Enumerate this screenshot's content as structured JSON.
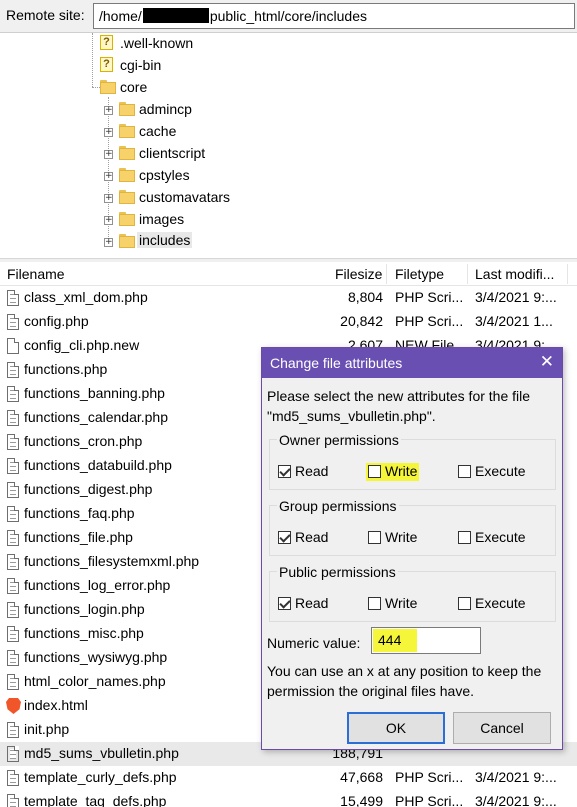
{
  "remote_bar": {
    "label": "Remote site:",
    "path_prefix": "/home/",
    "path_suffix": "public_html/core/includes"
  },
  "tree": {
    "items": [
      {
        "label": ".well-known",
        "icon": "question-icon"
      },
      {
        "label": "cgi-bin",
        "icon": "question-icon"
      },
      {
        "label": "core",
        "icon": "folder-icon"
      },
      {
        "label": "admincp",
        "icon": "folder-icon"
      },
      {
        "label": "cache",
        "icon": "folder-icon"
      },
      {
        "label": "clientscript",
        "icon": "folder-icon"
      },
      {
        "label": "cpstyles",
        "icon": "folder-icon"
      },
      {
        "label": "customavatars",
        "icon": "folder-icon"
      },
      {
        "label": "images",
        "icon": "folder-icon"
      },
      {
        "label": "includes",
        "icon": "folder-icon"
      }
    ],
    "expander_symbol": "+",
    "scroll_up_symbol": "^"
  },
  "filelist": {
    "headers": {
      "filename": "Filename",
      "filesize": "Filesize",
      "filetype": "Filetype",
      "last_modified": "Last modifi..."
    },
    "rows": [
      {
        "name": "class_xml_dom.php",
        "size": "8,804",
        "type": "PHP Scri...",
        "date": "3/4/2021 9:...",
        "icon": "file-lines-icon"
      },
      {
        "name": "config.php",
        "size": "20,842",
        "type": "PHP Scri...",
        "date": "3/4/2021 1...",
        "icon": "file-lines-icon"
      },
      {
        "name": "config_cli.php.new",
        "size": "2,607",
        "type": "NEW File",
        "date": "3/4/2021 9:...",
        "icon": "file-blank-icon"
      },
      {
        "name": "functions.php",
        "size": "",
        "type": "",
        "date": "",
        "icon": "file-lines-icon"
      },
      {
        "name": "functions_banning.php",
        "size": "",
        "type": "",
        "date": "",
        "icon": "file-lines-icon"
      },
      {
        "name": "functions_calendar.php",
        "size": "",
        "type": "",
        "date": "",
        "icon": "file-lines-icon"
      },
      {
        "name": "functions_cron.php",
        "size": "",
        "type": "",
        "date": "",
        "icon": "file-lines-icon"
      },
      {
        "name": "functions_databuild.php",
        "size": "",
        "type": "",
        "date": "",
        "icon": "file-lines-icon"
      },
      {
        "name": "functions_digest.php",
        "size": "",
        "type": "",
        "date": "",
        "icon": "file-lines-icon"
      },
      {
        "name": "functions_faq.php",
        "size": "",
        "type": "",
        "date": "",
        "icon": "file-lines-icon"
      },
      {
        "name": "functions_file.php",
        "size": "",
        "type": "",
        "date": "",
        "icon": "file-lines-icon"
      },
      {
        "name": "functions_filesystemxml.php",
        "size": "",
        "type": "",
        "date": "",
        "icon": "file-lines-icon"
      },
      {
        "name": "functions_log_error.php",
        "size": "",
        "type": "",
        "date": "",
        "icon": "file-lines-icon"
      },
      {
        "name": "functions_login.php",
        "size": "",
        "type": "",
        "date": "",
        "icon": "file-lines-icon"
      },
      {
        "name": "functions_misc.php",
        "size": "",
        "type": "",
        "date": "",
        "icon": "file-lines-icon"
      },
      {
        "name": "functions_wysiwyg.php",
        "size": "",
        "type": "",
        "date": "",
        "icon": "file-lines-icon"
      },
      {
        "name": "html_color_names.php",
        "size": "",
        "type": "",
        "date": "",
        "icon": "file-lines-icon"
      },
      {
        "name": "index.html",
        "size": "",
        "type": "",
        "date": "",
        "icon": "brave-browser-icon"
      },
      {
        "name": "init.php",
        "size": "",
        "type": "",
        "date": "",
        "icon": "file-lines-icon"
      },
      {
        "name": "md5_sums_vbulletin.php",
        "size": "188,791",
        "type": "",
        "date": "",
        "icon": "file-lines-icon",
        "selected": true
      },
      {
        "name": "template_curly_defs.php",
        "size": "47,668",
        "type": "PHP Scri...",
        "date": "3/4/2021 9:...",
        "icon": "file-lines-icon"
      },
      {
        "name": "template_tag_defs.php",
        "size": "15,499",
        "type": "PHP Scri...",
        "date": "3/4/2021 9:...",
        "icon": "file-lines-icon"
      }
    ]
  },
  "dialog": {
    "title": "Change file attributes",
    "close_symbol": "✕",
    "prompt": "Please select the new attributes for the file \"md5_sums_vbulletin.php\".",
    "groups": [
      {
        "legend": "Owner permissions",
        "read": "Read",
        "write": "Write",
        "execute": "Execute",
        "read_checked": true,
        "write_checked": false,
        "execute_checked": false
      },
      {
        "legend": "Group permissions",
        "read": "Read",
        "write": "Write",
        "execute": "Execute",
        "read_checked": true,
        "write_checked": false,
        "execute_checked": false
      },
      {
        "legend": "Public permissions",
        "read": "Read",
        "write": "Write",
        "execute": "Execute",
        "read_checked": true,
        "write_checked": false,
        "execute_checked": false
      }
    ],
    "numeric_label": "Numeric value:",
    "numeric_value": "444",
    "note": "You can use an x at any position to keep the permission the original files have.",
    "ok_label": "OK",
    "cancel_label": "Cancel",
    "title_bar_color": "#6a4fb3",
    "highlight_color": "#f5f53a"
  }
}
